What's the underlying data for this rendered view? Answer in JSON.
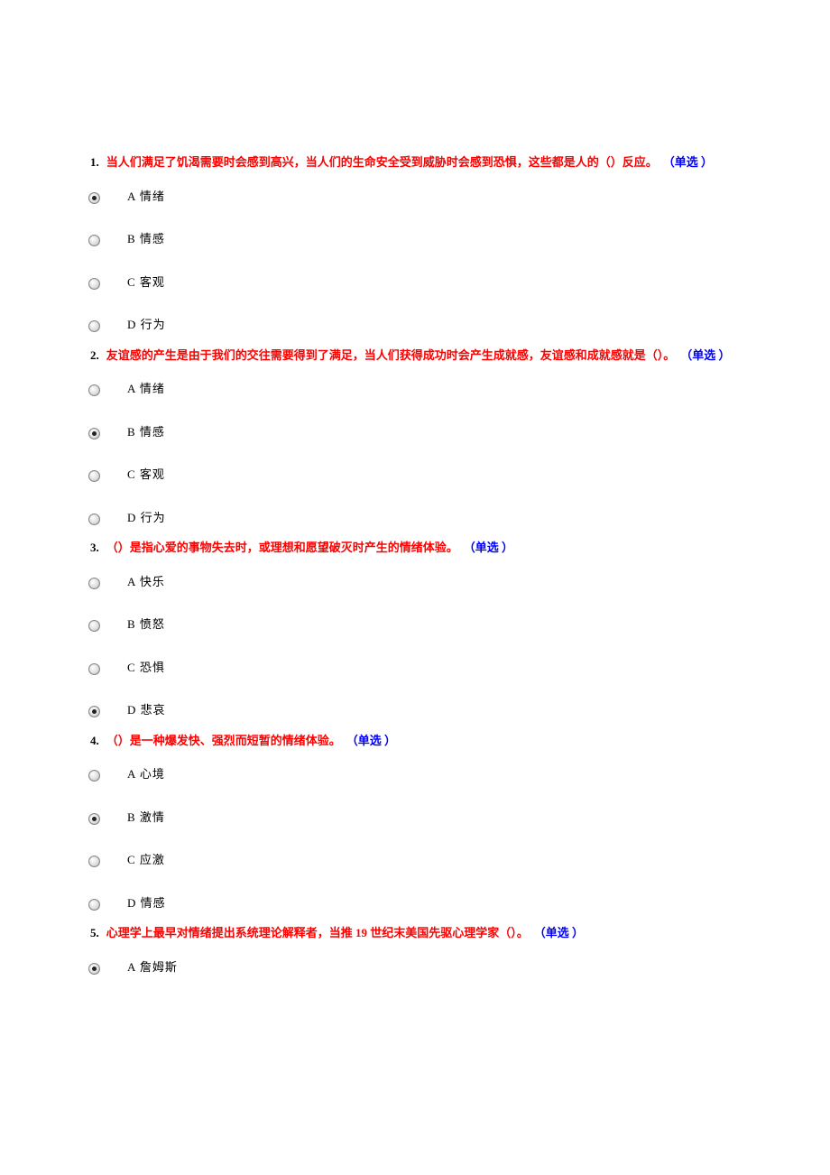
{
  "questions": [
    {
      "number": "1.",
      "text": "当人们满足了饥渴需要时会感到高兴，当人们的生命安全受到威胁时会感到恐惧，这些都是人的（）反应。",
      "type": "（单选 ）",
      "options": [
        {
          "label": "A 情绪",
          "selected": true
        },
        {
          "label": "B 情感",
          "selected": false
        },
        {
          "label": "C 客观",
          "selected": false
        },
        {
          "label": "D 行为",
          "selected": false
        }
      ]
    },
    {
      "number": "2.",
      "text": "友谊感的产生是由于我们的交往需要得到了满足，当人们获得成功时会产生成就感，友谊感和成就感就是（）。",
      "type": "（单选 ）",
      "options": [
        {
          "label": "A 情绪",
          "selected": false
        },
        {
          "label": "B 情感",
          "selected": true
        },
        {
          "label": "C 客观",
          "selected": false
        },
        {
          "label": "D 行为",
          "selected": false
        }
      ]
    },
    {
      "number": "3.",
      "text": "（）是指心爱的事物失去时，或理想和愿望破灭时产生的情绪体验。",
      "type": "（单选 ）",
      "options": [
        {
          "label": "A 快乐",
          "selected": false
        },
        {
          "label": "B 愤怒",
          "selected": false
        },
        {
          "label": "C 恐惧",
          "selected": false
        },
        {
          "label": "D 悲哀",
          "selected": true
        }
      ]
    },
    {
      "number": "4.",
      "text": "（）是一种爆发快、强烈而短暂的情绪体验。",
      "type": "（单选 ）",
      "options": [
        {
          "label": "A 心境",
          "selected": false
        },
        {
          "label": "B 激情",
          "selected": true
        },
        {
          "label": "C 应激",
          "selected": false
        },
        {
          "label": "D 情感",
          "selected": false
        }
      ]
    },
    {
      "number": "5.",
      "text": "心理学上最早对情绪提出系统理论解释者，当推 19 世纪末美国先驱心理学家（）。",
      "type": "（单选 ）",
      "options": [
        {
          "label": "A 詹姆斯",
          "selected": true
        }
      ]
    }
  ]
}
